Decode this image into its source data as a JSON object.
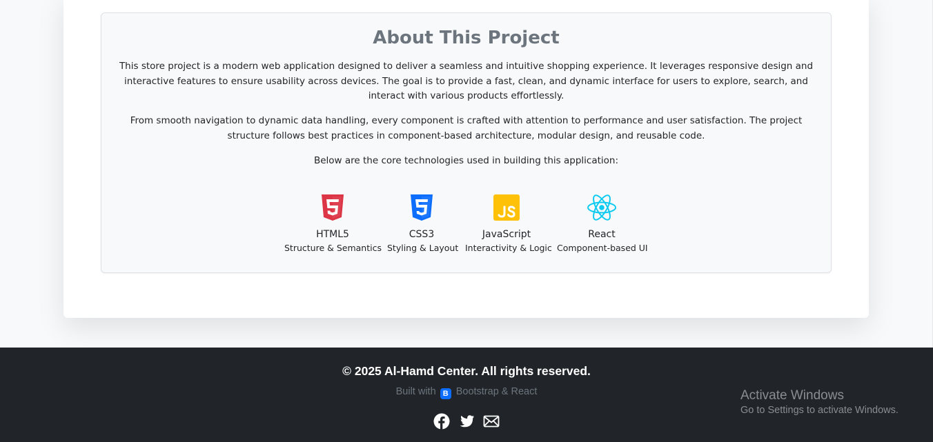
{
  "about": {
    "title": "About This Project",
    "paragraph1": "This store project is a modern web application designed to deliver a seamless and intuitive shopping experience. It leverages responsive design and interactive features to ensure usability across devices. The goal is to provide a fast, clean, and dynamic interface for users to explore, search, and interact with various products effortlessly.",
    "paragraph2": "From smooth navigation to dynamic data handling, every component is crafted with attention to performance and user satisfaction. The project structure follows best practices in component-based architecture, modular design, and reusable code.",
    "paragraph3": "Below are the core technologies used in building this application:",
    "technologies": [
      {
        "name": "HTML5",
        "description": "Structure & Semantics",
        "icon": "html5-icon",
        "color": "#dc3545"
      },
      {
        "name": "CSS3",
        "description": "Styling & Layout",
        "icon": "css3-icon",
        "color": "#0d6efd"
      },
      {
        "name": "JavaScript",
        "description": "Interactivity & Logic",
        "icon": "javascript-icon",
        "color": "#ffc107"
      },
      {
        "name": "React",
        "description": "Component-based UI",
        "icon": "react-icon",
        "color": "#0dcaf0"
      }
    ]
  },
  "footer": {
    "copyright": "© 2025 Al-Hamd Center. All rights reserved.",
    "built_prefix": "Built with",
    "bootstrap_badge": "B",
    "built_suffix": "Bootstrap & React",
    "social_icons": [
      "facebook-icon",
      "twitter-icon",
      "email-icon"
    ]
  },
  "watermark": {
    "title": "Activate Windows",
    "subtitle": "Go to Settings to activate Windows."
  },
  "colors": {
    "footer_bg": "#212529",
    "muted": "#6c757d",
    "card_bg": "#f8f9fa"
  }
}
